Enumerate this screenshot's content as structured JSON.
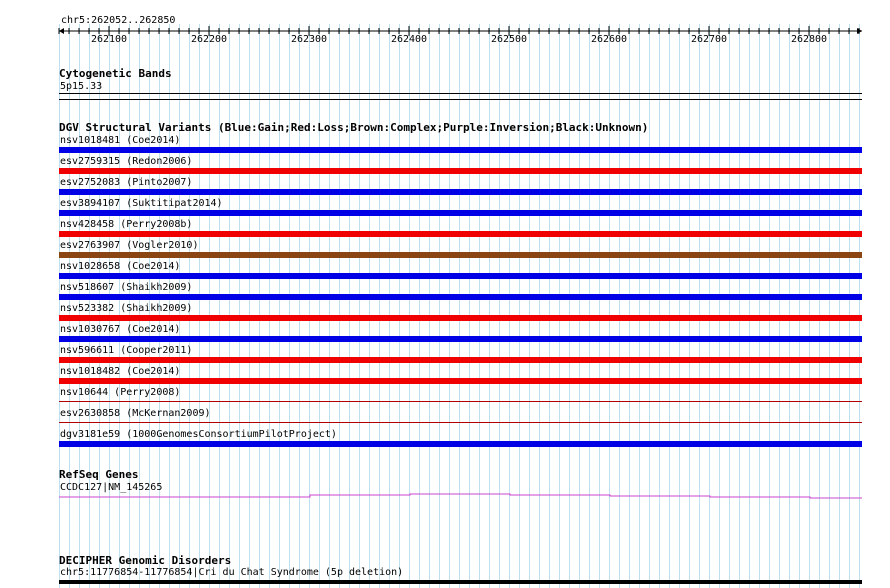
{
  "ruler": {
    "location": "chr5:262052..262850",
    "ticks": [
      "262100",
      "262200",
      "262300",
      "262400",
      "262500",
      "262600",
      "262700",
      "262800"
    ]
  },
  "cytoband": {
    "title": "Cytogenetic Bands",
    "band": "5p15.33"
  },
  "dgv": {
    "title": "DGV Structural Variants (Blue:Gain;Red:Loss;Brown:Complex;Purple:Inversion;Black:Unknown)",
    "colors": {
      "gain": "#0000e6",
      "loss": "#f00000",
      "complex": "#8b4513"
    },
    "variants": [
      {
        "label": "nsv1018481 (Coe2014)",
        "type": "gain"
      },
      {
        "label": "esv2759315 (Redon2006)",
        "type": "loss"
      },
      {
        "label": "esv2752083 (Pinto2007)",
        "type": "gain"
      },
      {
        "label": "esv3894107 (Suktitipat2014)",
        "type": "gain"
      },
      {
        "label": "nsv428458 (Perry2008b)",
        "type": "loss"
      },
      {
        "label": "esv2763907 (Vogler2010)",
        "type": "complex"
      },
      {
        "label": "nsv1028658 (Coe2014)",
        "type": "gain"
      },
      {
        "label": "nsv518607 (Shaikh2009)",
        "type": "gain"
      },
      {
        "label": "nsv523382 (Shaikh2009)",
        "type": "loss"
      },
      {
        "label": "nsv1030767 (Coe2014)",
        "type": "gain"
      },
      {
        "label": "nsv596611 (Cooper2011)",
        "type": "loss"
      },
      {
        "label": "nsv1018482 (Coe2014)",
        "type": "loss"
      },
      {
        "label": "nsv10644 (Perry2008)",
        "type": "thin"
      },
      {
        "label": "esv2630858 (McKernan2009)",
        "type": "thin"
      },
      {
        "label": "dgv3181e59 (1000GenomesConsortiumPilotProject)",
        "type": "gain"
      }
    ]
  },
  "refseq": {
    "title": "RefSeq Genes",
    "gene": "CCDC127|NM_145265",
    "color": "#cc44cc"
  },
  "decipher": {
    "title": "DECIPHER Genomic Disorders",
    "entry": "chr5:11776854-11776854|Cri du Chat Syndrome (5p deletion)"
  }
}
